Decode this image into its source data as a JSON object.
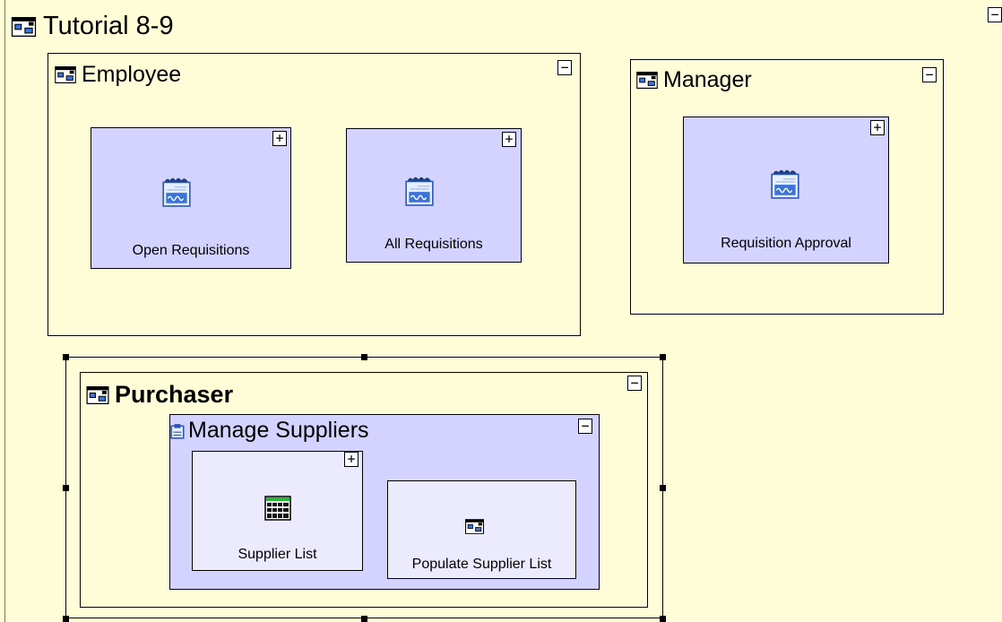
{
  "diagram": {
    "title": "Tutorial 8-9",
    "collapse_symbol": "−",
    "expand_symbol": "+",
    "frames": {
      "employee": {
        "title": "Employee",
        "pages": [
          {
            "label": "Open Requisitions",
            "icon": "report-icon"
          },
          {
            "label": "All Requisitions",
            "icon": "report-icon"
          }
        ]
      },
      "manager": {
        "title": "Manager",
        "pages": [
          {
            "label": "Requisition Approval",
            "icon": "report-icon"
          }
        ]
      },
      "purchaser": {
        "title": "Purchaser",
        "subframe": {
          "title": "Manage Suppliers",
          "pages": [
            {
              "label": "Supplier List",
              "icon": "table-icon"
            },
            {
              "label": "Populate Supplier List",
              "icon": "frame-icon"
            }
          ]
        }
      }
    }
  },
  "colors": {
    "background": "#fffcd8",
    "page_fill": "#d4d2fe",
    "page_fill_light": "#ecebfd",
    "icon_blue": "#3b74d8",
    "icon_green": "#2ab83a"
  }
}
